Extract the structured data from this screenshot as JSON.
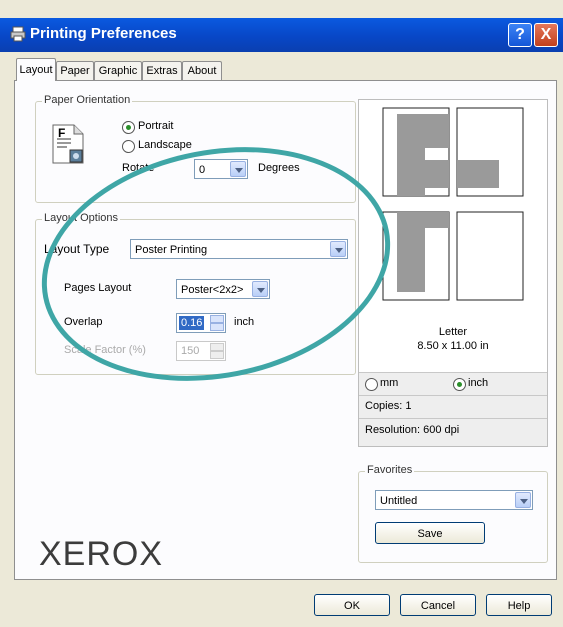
{
  "window": {
    "title": "Printing Preferences",
    "help_glyph": "?",
    "close_glyph": "X"
  },
  "tabs": [
    {
      "label": "Layout"
    },
    {
      "label": "Paper"
    },
    {
      "label": "Graphic"
    },
    {
      "label": "Extras"
    },
    {
      "label": "About"
    }
  ],
  "orientation": {
    "legend": "Paper Orientation",
    "portrait": "Portrait",
    "landscape": "Landscape",
    "rotate_label": "Rotate",
    "rotate_value": "0",
    "degrees": "Degrees",
    "icon_letter": "F"
  },
  "layout_options": {
    "legend": "Layout Options",
    "layout_type_label": "Layout Type",
    "layout_type_value": "Poster Printing",
    "pages_layout_label": "Pages Layout",
    "pages_layout_value": "Poster<2x2>",
    "overlap_label": "Overlap",
    "overlap_value": "0.16",
    "overlap_unit": "inch",
    "scale_label": "Scale Factor (%)",
    "scale_value": "150"
  },
  "preview": {
    "paper_name": "Letter",
    "paper_size": "8.50 x 11.00 in",
    "unit_mm": "mm",
    "unit_inch": "inch",
    "selected_unit": "inch",
    "copies": "Copies: 1",
    "resolution": "Resolution: 600 dpi"
  },
  "favorites": {
    "legend": "Favorites",
    "value": "Untitled",
    "save": "Save"
  },
  "brand": "XEROX",
  "buttons": {
    "ok": "OK",
    "cancel": "Cancel",
    "help": "Help"
  }
}
